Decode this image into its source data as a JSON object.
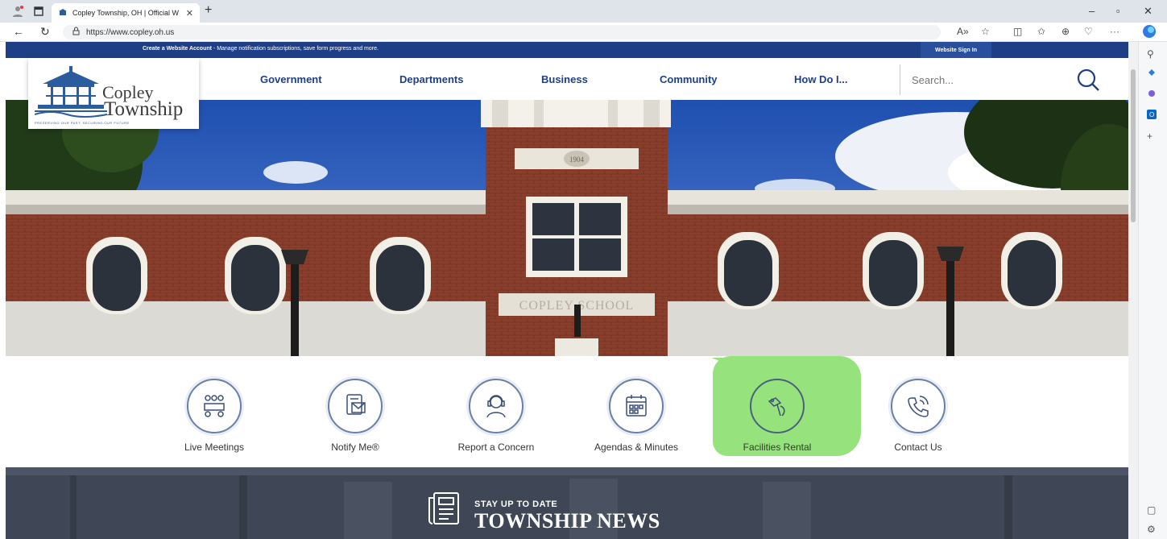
{
  "browser": {
    "tab_title": "Copley Township, OH | Official W",
    "url": "https://www.copley.oh.us"
  },
  "site": {
    "topbar": {
      "create_account": "Create a Website Account",
      "message": " - Manage notification subscriptions, save form progress and more.",
      "sign_in": "Website Sign In"
    },
    "logo": {
      "line1": "Copley",
      "line2": "Township",
      "tagline": "PRESERVING OUR PAST, SECURING OUR FUTURE"
    },
    "nav": [
      {
        "label": "Government"
      },
      {
        "label": "Departments"
      },
      {
        "label": "Business"
      },
      {
        "label": "Community"
      },
      {
        "label": "How Do I..."
      }
    ],
    "search": {
      "placeholder": "Search..."
    },
    "hero": {
      "building_sign": "COPLEY SCHOOL",
      "year": "1904"
    },
    "quick_links": [
      {
        "label": "Live Meetings",
        "icon": "meeting-icon"
      },
      {
        "label": "Notify Me®",
        "icon": "notify-icon"
      },
      {
        "label": "Report a Concern",
        "icon": "report-icon"
      },
      {
        "label": "Agendas & Minutes",
        "icon": "calendar-icon"
      },
      {
        "label": "Facilities Rental",
        "icon": "key-icon"
      },
      {
        "label": "Contact Us",
        "icon": "phone-icon"
      }
    ],
    "news": {
      "subtitle": "STAY UP TO DATE",
      "title": "TOWNSHIP NEWS"
    }
  },
  "colors": {
    "brand": "#1e3f86",
    "highlight": "#96e37d"
  }
}
